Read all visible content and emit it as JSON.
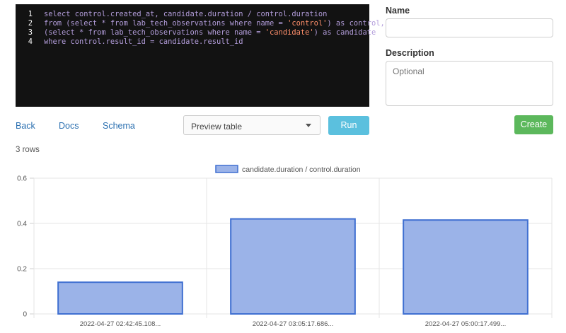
{
  "editor": {
    "lines": [
      {
        "n": "1",
        "parts": [
          {
            "t": "select control.created_at, candidate.duration / control.duration",
            "c": "kw"
          }
        ]
      },
      {
        "n": "2",
        "parts": [
          {
            "t": "from (select * from lab_tech_observations where name = ",
            "c": "kw"
          },
          {
            "t": "'control'",
            "c": "str"
          },
          {
            "t": ") as control,",
            "c": "kw"
          }
        ]
      },
      {
        "n": "3",
        "parts": [
          {
            "t": "(select * from lab_tech_observations where name = ",
            "c": "kw"
          },
          {
            "t": "'candidate'",
            "c": "str"
          },
          {
            "t": ") as candidate",
            "c": "kw"
          }
        ]
      },
      {
        "n": "4",
        "parts": [
          {
            "t": "where control.result_id = candidate.result_id",
            "c": "kw"
          }
        ]
      }
    ]
  },
  "form": {
    "name_label": "Name",
    "name_value": "",
    "description_label": "Description",
    "description_placeholder": "Optional",
    "create_label": "Create"
  },
  "nav": {
    "back": "Back",
    "docs": "Docs",
    "schema": "Schema"
  },
  "controls": {
    "preview_selected": "Preview table",
    "run_label": "Run"
  },
  "result": {
    "row_count": "3 rows"
  },
  "colors": {
    "bar_fill": "#9bb3e8",
    "bar_stroke": "#3f6fd1",
    "run_button": "#5bc0de",
    "create_button": "#5cb85c"
  },
  "chart_data": {
    "type": "bar",
    "categories": [
      "2022-04-27 02:42:45.108...",
      "2022-04-27 03:05:17.686...",
      "2022-04-27 05:00:17.499..."
    ],
    "series": [
      {
        "name": "candidate.duration / control.duration",
        "values": [
          0.14,
          0.42,
          0.415
        ]
      }
    ],
    "ylim": [
      0,
      0.6
    ],
    "yticks": [
      0,
      0.2,
      0.4,
      0.6
    ],
    "ytick_labels": [
      "0",
      "0.2",
      "0.4",
      "0.6"
    ],
    "legend_position": "top-center",
    "grid": true
  }
}
